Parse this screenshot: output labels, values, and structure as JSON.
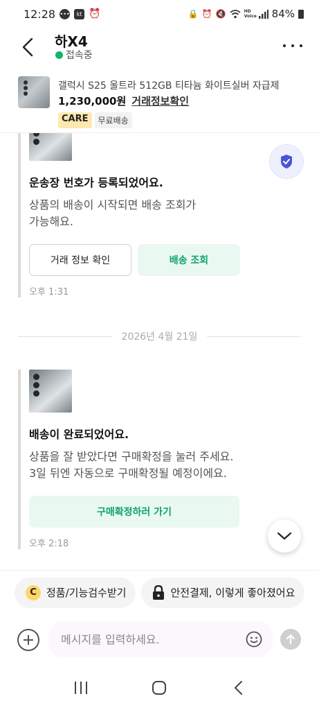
{
  "status_bar": {
    "time": "12:28",
    "left_icons": [
      "message-icon",
      "kt-icon",
      "alarm-icon"
    ],
    "right_icons": [
      "lock-icon",
      "alarm-icon",
      "mute-icon",
      "wifi-icon",
      "volte-icon",
      "signal-icon"
    ],
    "battery": "84%",
    "volte_label": "HD Voice"
  },
  "header": {
    "title": "하X4",
    "status": "접속중",
    "status_color": "#12b76a"
  },
  "product": {
    "name": "갤럭시 S25 울트라 512GB 티타늄 화이트실버 자급제",
    "price": "1,230,000원",
    "trade_link": "거래정보확인",
    "badge_care": "CARE",
    "badge_shipping": "무료배송"
  },
  "messages": [
    {
      "title": "운송장 번호가 등록되었어요.",
      "body_lines": [
        "상품의 배송이 시작되면 배송 조회가",
        "가능해요."
      ],
      "button_secondary": "거래 정보 확인",
      "button_primary": "배송 조회",
      "time": "오후 1:31"
    },
    {
      "title": "배송이 완료되었어요.",
      "body_lines": [
        "상품을 잘 받았다면 구매확정을 눌러 주세요.",
        "3일 뒤엔 자동으로 구매확정될 예정이에요."
      ],
      "button_primary": "구매확정하러 가기",
      "time": "오후 2:18"
    }
  ],
  "date_separator": "2026년 4월 21일",
  "chips": [
    {
      "icon_letter": "C",
      "label": "정품/기능검수받기"
    },
    {
      "icon": "lock-icon",
      "label": "안전결제, 이렇게 좋아졌어요"
    }
  ],
  "input": {
    "placeholder": "메시지를 입력하세요.",
    "value": ""
  },
  "colors": {
    "accent": "#0fa36b",
    "accent_bg": "#e9f8f1",
    "shield": "#4a55d6"
  }
}
